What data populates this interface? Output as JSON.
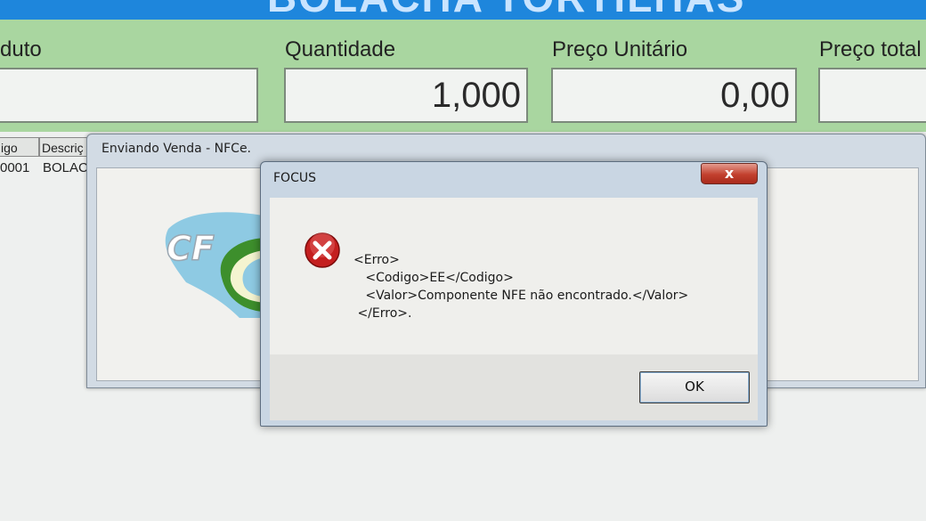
{
  "banner": {
    "title": "BOLACHA TORTILHAS"
  },
  "form": {
    "produto_label": "duto",
    "produto_value": "",
    "quantidade_label": "Quantidade",
    "quantidade_value": "1,000",
    "preco_unitario_label": "Preço Unitário",
    "preco_unitario_value": "0,00",
    "preco_total_label": "Preço total",
    "preco_total_value": ""
  },
  "grid": {
    "headers": [
      "igo",
      "Descriç"
    ],
    "row": [
      "0001",
      "BOLAC"
    ]
  },
  "back_window": {
    "title": "Enviando Venda - NFCe.",
    "logo_text": "CF"
  },
  "dialog": {
    "title": "FOCUS",
    "close_symbol": "x",
    "icon": "error-icon",
    "message_lines": [
      "<Erro>",
      "   <Codigo>EE</Codigo>",
      "   <Valor>Componente NFE não encontrado.</Valor>",
      " </Erro>."
    ],
    "ok_label": "OK"
  },
  "colors": {
    "banner": "#1e86dc",
    "form_background": "#a9d6a0",
    "error_red": "#c41f1f",
    "close_button": "#c2402e"
  }
}
